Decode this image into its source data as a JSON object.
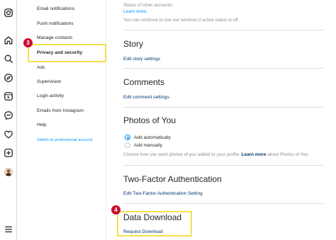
{
  "rail": {
    "icons": [
      "instagram-icon",
      "home-icon",
      "search-icon",
      "explore-icon",
      "reels-icon",
      "messenger-icon",
      "notifications-heart-icon",
      "create-plus-icon",
      "profile-avatar",
      "menu-hamburger-icon"
    ]
  },
  "nav": {
    "items": [
      {
        "label": "Email notifications"
      },
      {
        "label": "Push notifications"
      },
      {
        "label": "Manage contacts"
      },
      {
        "label": "Privacy and security"
      },
      {
        "label": "Ads"
      },
      {
        "label": "Supervision"
      },
      {
        "label": "Login activity"
      },
      {
        "label": "Emails from Instagram"
      },
      {
        "label": "Help"
      },
      {
        "label": "Switch to professional account"
      }
    ],
    "step_badge": "3"
  },
  "main": {
    "activity": {
      "line1": "Status of other accounts.",
      "learn_more": "Learn more",
      "line2": "You can continue to use our services if active status is off."
    },
    "story": {
      "title": "Story",
      "link": "Edit story settings"
    },
    "comments": {
      "title": "Comments",
      "link": "Edit comment settings"
    },
    "photos": {
      "title": "Photos of You",
      "option1": "Add automatically",
      "option2": "Add manually",
      "help_before": "Choose how you want photos of you added to your profile.",
      "help_link": "Learn more",
      "help_after": "about Photos of You."
    },
    "two_factor": {
      "title": "Two-Factor Authentication",
      "link": "Edit Two-Factor Authentication Setting"
    },
    "data_download": {
      "title": "Data Download",
      "link": "Request Download",
      "step_badge": "4"
    }
  },
  "colors": {
    "accent": "#0095f6",
    "highlight": "#f4e04d",
    "badge": "#c8102e"
  }
}
